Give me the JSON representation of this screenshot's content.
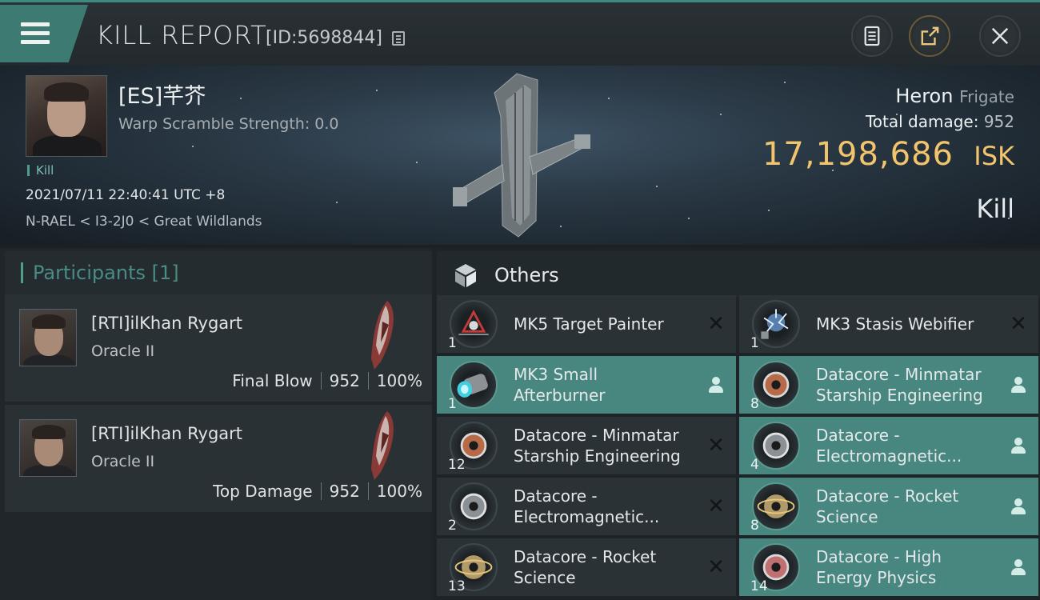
{
  "header": {
    "title": "KILL REPORT",
    "report_id": "[ID:5698844]",
    "buttons": {
      "notes": "notes-icon",
      "share": "share-icon",
      "close": "close-icon"
    }
  },
  "victim": {
    "name": "[ES]芊芥",
    "warp_scramble": "Warp Scramble Strength: 0.0",
    "tag": "Kill",
    "timestamp": "2021/07/11 22:40:41 UTC +8",
    "location": "N-RAEL < I3-2J0 < Great Wildlands",
    "ship_name": "Heron",
    "ship_class": "Frigate",
    "damage_label": "Total damage:",
    "damage_value": "952",
    "isk_value": "17,198,686",
    "isk_unit": "ISK",
    "result": "Kill"
  },
  "participants": {
    "title": "Participants [1]",
    "rows": [
      {
        "name": "[RTI]ilKhan Rygart",
        "ship": "Oracle II",
        "role": "Final Blow",
        "damage": "952",
        "percent": "100%"
      },
      {
        "name": "[RTI]ilKhan Rygart",
        "ship": "Oracle II",
        "role": "Top Damage",
        "damage": "952",
        "percent": "100%"
      }
    ]
  },
  "items": {
    "title": "Others",
    "list": [
      {
        "name": "MK5 Target Painter",
        "qty": "1",
        "status": "destroyed",
        "icon": "target-painter-icon"
      },
      {
        "name": "MK3 Stasis Webifier",
        "qty": "1",
        "status": "destroyed",
        "icon": "stasis-webifier-icon"
      },
      {
        "name": "MK3 Small Afterburner",
        "qty": "1",
        "status": "dropped",
        "icon": "afterburner-icon"
      },
      {
        "name": "Datacore - Minmatar Starship Engineering",
        "qty": "8",
        "status": "dropped",
        "icon": "datacore-icon"
      },
      {
        "name": "Datacore - Minmatar Starship Engineering",
        "qty": "12",
        "status": "destroyed",
        "icon": "datacore-icon"
      },
      {
        "name": "Datacore - Electromagnetic...",
        "qty": "4",
        "status": "dropped",
        "icon": "datacore-icon"
      },
      {
        "name": "Datacore - Electromagnetic...",
        "qty": "2",
        "status": "destroyed",
        "icon": "datacore-icon"
      },
      {
        "name": "Datacore - Rocket Science",
        "qty": "8",
        "status": "dropped",
        "icon": "datacore-icon"
      },
      {
        "name": "Datacore - Rocket Science",
        "qty": "13",
        "status": "destroyed",
        "icon": "datacore-icon"
      },
      {
        "name": "Datacore - High Energy Physics",
        "qty": "14",
        "status": "dropped",
        "icon": "datacore-icon"
      }
    ]
  },
  "colors": {
    "accent": "#4e9d8f",
    "isk": "#f2c56c",
    "dropped_row": "#48877f",
    "destroyed_row": "#2b3236"
  }
}
